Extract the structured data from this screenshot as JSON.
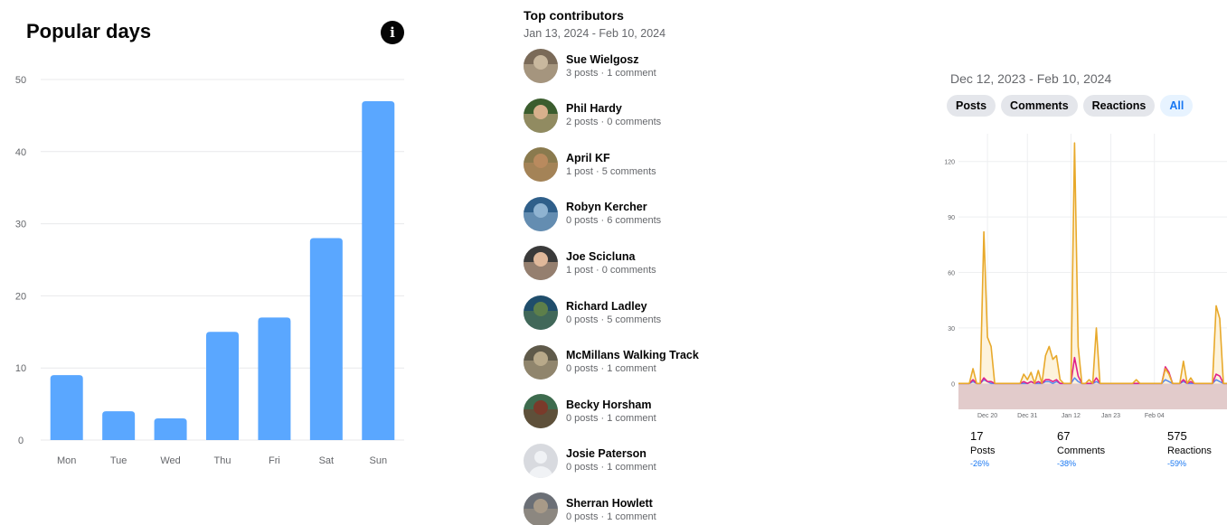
{
  "popular_days": {
    "title": "Popular days",
    "info_icon": "info-icon"
  },
  "top_contributors": {
    "title": "Top contributors",
    "date_range": "Jan 13, 2024 - Feb 10, 2024",
    "items": [
      {
        "name": "Sue Wielgosz",
        "stats": "3 posts · 1 comment",
        "avatar": "photo"
      },
      {
        "name": "Phil Hardy",
        "stats": "2 posts · 0 comments",
        "avatar": "photo"
      },
      {
        "name": "April KF",
        "stats": "1 post · 5 comments",
        "avatar": "photo"
      },
      {
        "name": "Robyn Kercher",
        "stats": "0 posts · 6 comments",
        "avatar": "photo"
      },
      {
        "name": "Joe Scicluna",
        "stats": "1 post · 0 comments",
        "avatar": "photo"
      },
      {
        "name": "Richard Ladley",
        "stats": "0 posts · 5 comments",
        "avatar": "photo"
      },
      {
        "name": "McMillans Walking Track",
        "stats": "0 posts · 1 comment",
        "avatar": "photo"
      },
      {
        "name": "Becky Horsham",
        "stats": "0 posts · 1 comment",
        "avatar": "photo"
      },
      {
        "name": "Josie Paterson",
        "stats": "0 posts · 1 comment",
        "avatar": "default"
      },
      {
        "name": "Sherran Howlett",
        "stats": "0 posts · 1 comment",
        "avatar": "photo"
      }
    ]
  },
  "activity": {
    "date_range": "Dec 12, 2023 - Feb 10, 2024",
    "filters": [
      "Posts",
      "Comments",
      "Reactions",
      "All"
    ],
    "active_filter": "All",
    "totals": [
      {
        "value": "17",
        "label": "Posts",
        "change": "-26%"
      },
      {
        "value": "67",
        "label": "Comments",
        "change": "-38%"
      },
      {
        "value": "575",
        "label": "Reactions",
        "change": "-59%"
      }
    ]
  },
  "chart_data": [
    {
      "type": "bar",
      "title": "Popular days",
      "categories": [
        "Mon",
        "Tue",
        "Wed",
        "Thu",
        "Fri",
        "Sat",
        "Sun"
      ],
      "values": [
        9,
        4,
        3,
        15,
        17,
        28,
        47
      ],
      "ylim": [
        0,
        50
      ],
      "yticks": [
        0,
        10,
        20,
        30,
        40,
        50
      ],
      "grid": true,
      "color": "#5aa7ff"
    },
    {
      "type": "line",
      "x_ticks": [
        "Dec 20",
        "Dec 31",
        "Jan 12",
        "Jan 23",
        "Feb 04"
      ],
      "x_tick_index": [
        8,
        19,
        31,
        42,
        54
      ],
      "ylim": [
        -14,
        135
      ],
      "yticks": [
        0,
        30,
        60,
        90,
        120
      ],
      "grid": true,
      "series": [
        {
          "color": "#e8a92b",
          "fill": "#fdf3dc",
          "values": [
            0,
            0,
            0,
            0,
            8,
            0,
            0,
            82,
            25,
            20,
            0,
            0,
            0,
            0,
            0,
            0,
            0,
            0,
            5,
            2,
            6,
            0,
            7,
            0,
            15,
            20,
            13,
            15,
            2,
            0,
            0,
            0,
            130,
            20,
            0,
            0,
            2,
            0,
            30,
            0,
            0,
            0,
            0,
            0,
            0,
            0,
            0,
            0,
            0,
            2,
            0,
            0,
            0,
            0,
            0,
            0,
            0,
            8,
            5,
            0,
            0,
            0,
            12,
            0,
            3,
            0,
            0,
            0,
            0,
            0,
            0,
            42,
            35,
            0,
            0
          ]
        },
        {
          "color": "#e0218a",
          "values": [
            0,
            0,
            0,
            0,
            2,
            0,
            0,
            3,
            1,
            1,
            0,
            0,
            0,
            0,
            0,
            0,
            0,
            0,
            1,
            0,
            1,
            0,
            1,
            0,
            2,
            2,
            1,
            2,
            0,
            0,
            0,
            0,
            14,
            4,
            0,
            0,
            0,
            0,
            3,
            0,
            0,
            0,
            0,
            0,
            0,
            0,
            0,
            0,
            0,
            0,
            0,
            0,
            0,
            0,
            0,
            0,
            0,
            9,
            6,
            0,
            0,
            0,
            2,
            0,
            1,
            0,
            0,
            0,
            0,
            0,
            0,
            5,
            4,
            0,
            0
          ]
        },
        {
          "color": "#5a8dee",
          "values": [
            0,
            0,
            0,
            0,
            1,
            0,
            0,
            2,
            1,
            0,
            0,
            0,
            0,
            0,
            0,
            0,
            0,
            0,
            0,
            0,
            1,
            0,
            0,
            0,
            1,
            1,
            0,
            1,
            0,
            0,
            0,
            0,
            3,
            1,
            0,
            0,
            0,
            0,
            1,
            0,
            0,
            0,
            0,
            0,
            0,
            0,
            0,
            0,
            0,
            0,
            0,
            0,
            0,
            0,
            0,
            0,
            0,
            2,
            1,
            0,
            0,
            0,
            1,
            0,
            0,
            0,
            0,
            0,
            0,
            0,
            0,
            2,
            1,
            0,
            0
          ]
        }
      ],
      "baseline_band_color": "#e2cbcb"
    }
  ]
}
